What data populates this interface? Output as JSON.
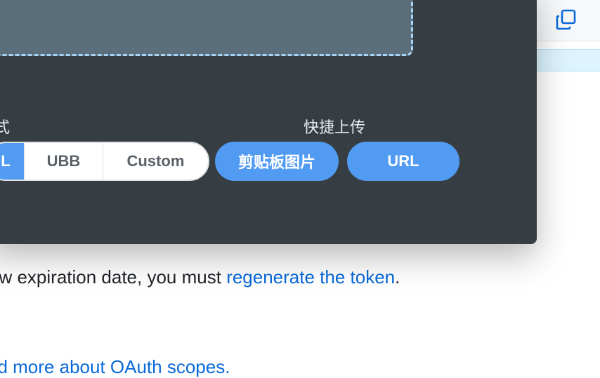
{
  "background": {
    "text_before_link": "ew expiration date, you must ",
    "link_text": "regenerate the token",
    "text_after_link": ".",
    "bottom_link_text": "ad more about OAuth scopes."
  },
  "copy_button": {
    "icon": "copy-icon"
  },
  "modal": {
    "left_label": "式",
    "quick_upload_label": "快捷上传",
    "format_options": [
      {
        "label": "L",
        "active": true
      },
      {
        "label": "UBB",
        "active": false
      },
      {
        "label": "Custom",
        "active": false
      }
    ],
    "quick_buttons": [
      {
        "label": "剪贴板图片"
      },
      {
        "label": "URL"
      }
    ]
  },
  "colors": {
    "modal_bg": "#373e43",
    "accent": "#519bf3",
    "dropzone_bg": "#5b6e7c",
    "dropzone_border": "#a8d4f5",
    "link": "#0969da"
  }
}
